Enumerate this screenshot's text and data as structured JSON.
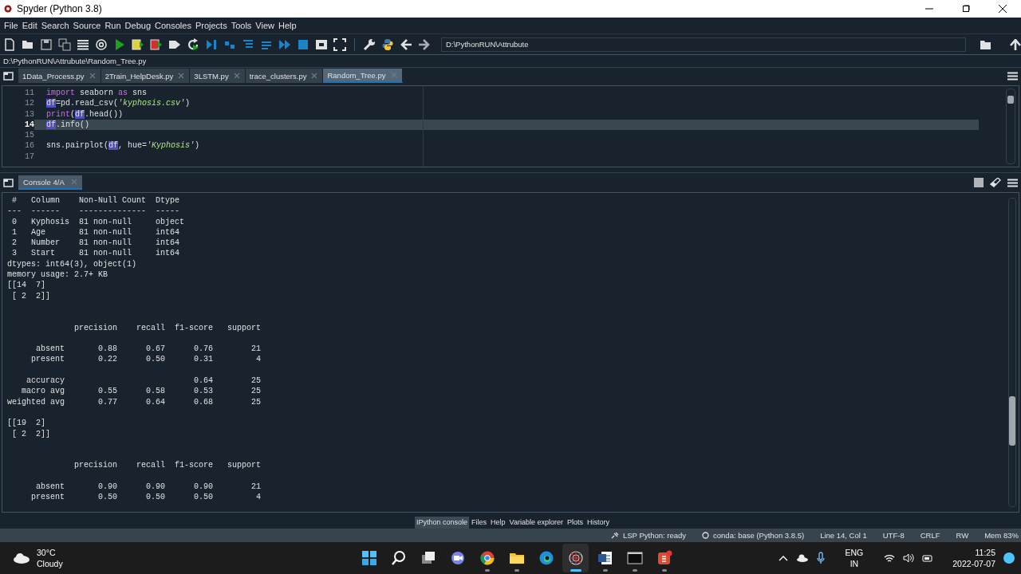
{
  "window": {
    "title": "Spyder (Python 3.8)"
  },
  "menu": [
    "File",
    "Edit",
    "Search",
    "Source",
    "Run",
    "Debug",
    "Consoles",
    "Projects",
    "Tools",
    "View",
    "Help"
  ],
  "toolbar": {
    "working_directory": "D:\\PythonRUN\\Attrubute"
  },
  "file_path": "D:\\PythonRUN\\Attrubute\\Random_Tree.py",
  "editor": {
    "tabs": [
      {
        "label": "1Data_Process.py",
        "selected": false
      },
      {
        "label": "2Train_HelpDesk.py",
        "selected": false
      },
      {
        "label": "3LSTM.py",
        "selected": false
      },
      {
        "label": "trace_clusters.py",
        "selected": false
      },
      {
        "label": "Random_Tree.py",
        "selected": true
      }
    ],
    "lines": [
      {
        "number": "11",
        "current": false,
        "tokens": [
          {
            "kind": "keyword",
            "text": "import"
          },
          {
            "kind": "plain",
            "text": " seaborn "
          },
          {
            "kind": "keyword",
            "text": "as"
          },
          {
            "kind": "plain",
            "text": " sns"
          }
        ]
      },
      {
        "number": "12",
        "current": false,
        "tokens": [
          {
            "kind": "occurrence",
            "text": "df"
          },
          {
            "kind": "plain",
            "text": "=pd.read_csv("
          },
          {
            "kind": "string",
            "text": "'kyphosis.csv'"
          },
          {
            "kind": "plain",
            "text": ")"
          }
        ]
      },
      {
        "number": "13",
        "current": false,
        "tokens": [
          {
            "kind": "keyword",
            "text": "print"
          },
          {
            "kind": "plain",
            "text": "("
          },
          {
            "kind": "occurrence",
            "text": "df"
          },
          {
            "kind": "plain",
            "text": ".head())"
          }
        ]
      },
      {
        "number": "14",
        "current": true,
        "tokens": [
          {
            "kind": "occurrence",
            "text": "df"
          },
          {
            "kind": "plain",
            "text": ".info()"
          }
        ]
      },
      {
        "number": "15",
        "current": false
      },
      {
        "number": "16",
        "current": false,
        "tokens": [
          {
            "kind": "plain",
            "text": "sns.pairplot("
          },
          {
            "kind": "occurrence",
            "text": "df"
          },
          {
            "kind": "plain",
            "text": ", hue="
          },
          {
            "kind": "string",
            "text": "'Kyphosis'"
          },
          {
            "kind": "plain",
            "text": ")"
          }
        ]
      },
      {
        "number": "17",
        "current": false
      }
    ]
  },
  "console": {
    "tabs": [
      {
        "label": "Console 4/A",
        "selected": true
      }
    ],
    "output": [
      {
        "kind": "text",
        "text": " #   Column    Non-Null Count  Dtype"
      },
      {
        "kind": "text",
        "text": "---  ------    --------------  -----"
      },
      {
        "kind": "text",
        "text": " 0   Kyphosis  81 non-null     object"
      },
      {
        "kind": "text",
        "text": " 1   Age       81 non-null     int64"
      },
      {
        "kind": "text",
        "text": " 2   Number    81 non-null     int64"
      },
      {
        "kind": "text",
        "text": " 3   Start     81 non-null     int64"
      },
      {
        "kind": "text",
        "text": "dtypes: int64(3), object(1)"
      },
      {
        "kind": "text",
        "text": "memory usage: 2.7+ KB"
      },
      {
        "kind": "text",
        "text": "[[14  7]"
      },
      {
        "kind": "text",
        "text": " [ 2  2]]"
      },
      {
        "kind": "blank"
      },
      {
        "kind": "blank"
      },
      {
        "kind": "text",
        "text": "              precision    recall  f1-score   support"
      },
      {
        "kind": "blank"
      },
      {
        "kind": "text",
        "text": "      absent       0.88      0.67      0.76        21"
      },
      {
        "kind": "text",
        "text": "     present       0.22      0.50      0.31         4"
      },
      {
        "kind": "blank"
      },
      {
        "kind": "text",
        "text": "    accuracy                           0.64        25"
      },
      {
        "kind": "text",
        "text": "   macro avg       0.55      0.58      0.53        25"
      },
      {
        "kind": "text",
        "text": "weighted avg       0.77      0.64      0.68        25"
      },
      {
        "kind": "blank"
      },
      {
        "kind": "text",
        "text": "[[19  2]"
      },
      {
        "kind": "text",
        "text": " [ 2  2]]"
      },
      {
        "kind": "blank"
      },
      {
        "kind": "blank"
      },
      {
        "kind": "text",
        "text": "              precision    recall  f1-score   support"
      },
      {
        "kind": "blank"
      },
      {
        "kind": "text",
        "text": "      absent       0.90      0.90      0.90        21"
      },
      {
        "kind": "text",
        "text": "     present       0.50      0.50      0.50         4"
      }
    ]
  },
  "panes": [
    {
      "label": "IPython console",
      "selected": true
    },
    {
      "label": "Files",
      "selected": false
    },
    {
      "label": "Help",
      "selected": false
    },
    {
      "label": "Variable explorer",
      "selected": false
    },
    {
      "label": "Plots",
      "selected": false
    },
    {
      "label": "History",
      "selected": false
    }
  ],
  "status_bar": [
    {
      "kind": "lsp",
      "text": "LSP Python: ready"
    },
    {
      "kind": "conda",
      "text": "conda: base (Python 3.8.5)"
    },
    {
      "kind": "plain",
      "text": "Line 14, Col 1"
    },
    {
      "kind": "plain",
      "text": "UTF-8"
    },
    {
      "kind": "plain",
      "text": "CRLF"
    },
    {
      "kind": "plain",
      "text": "RW"
    },
    {
      "kind": "plain",
      "text": "Mem 83%"
    }
  ],
  "taskbar": {
    "weather": {
      "temperature": "30°C",
      "condition": "Cloudy"
    },
    "apps": [
      {
        "kind": "start",
        "running": false,
        "active": false
      },
      {
        "kind": "search",
        "running": false,
        "active": false
      },
      {
        "kind": "taskview",
        "running": false,
        "active": false
      },
      {
        "kind": "chat",
        "running": false,
        "active": false
      },
      {
        "kind": "browser",
        "running": true,
        "active": false
      },
      {
        "kind": "files",
        "running": true,
        "active": false
      },
      {
        "kind": "edge",
        "running": false,
        "active": false
      },
      {
        "kind": "spyder",
        "running": true,
        "active": true
      },
      {
        "kind": "word",
        "running": true,
        "active": false
      },
      {
        "kind": "terminal",
        "running": true,
        "active": false
      },
      {
        "kind": "slides",
        "running": true,
        "active": false
      }
    ],
    "language": "ENG",
    "region": "IN",
    "time": "11:25",
    "date": "2022-07-07"
  }
}
